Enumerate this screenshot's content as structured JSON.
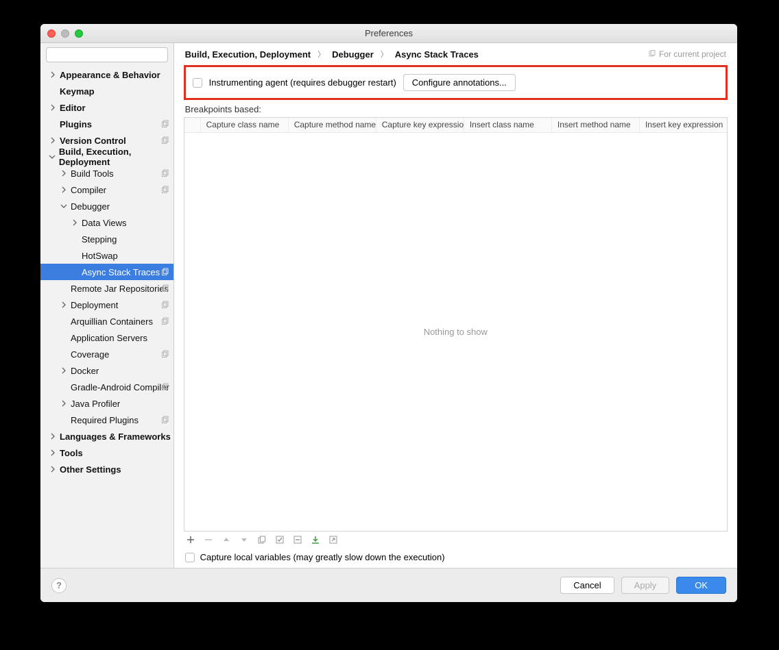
{
  "window": {
    "title": "Preferences"
  },
  "search": {
    "placeholder": ""
  },
  "sidebar": {
    "items": [
      {
        "label": "Appearance & Behavior",
        "indent": 0,
        "expand": "collapsed",
        "bold": true
      },
      {
        "label": "Keymap",
        "indent": 0,
        "expand": "none",
        "bold": true
      },
      {
        "label": "Editor",
        "indent": 0,
        "expand": "collapsed",
        "bold": true
      },
      {
        "label": "Plugins",
        "indent": 0,
        "expand": "none",
        "bold": true,
        "badge": true
      },
      {
        "label": "Version Control",
        "indent": 0,
        "expand": "collapsed",
        "bold": true,
        "badge": true
      },
      {
        "label": "Build, Execution, Deployment",
        "indent": 0,
        "expand": "expanded",
        "bold": true
      },
      {
        "label": "Build Tools",
        "indent": 1,
        "expand": "collapsed",
        "badge": true
      },
      {
        "label": "Compiler",
        "indent": 1,
        "expand": "collapsed",
        "badge": true
      },
      {
        "label": "Debugger",
        "indent": 1,
        "expand": "expanded"
      },
      {
        "label": "Data Views",
        "indent": 2,
        "expand": "collapsed"
      },
      {
        "label": "Stepping",
        "indent": 2,
        "expand": "none"
      },
      {
        "label": "HotSwap",
        "indent": 2,
        "expand": "none"
      },
      {
        "label": "Async Stack Traces",
        "indent": 2,
        "expand": "none",
        "selected": true,
        "badge": true
      },
      {
        "label": "Remote Jar Repositories",
        "indent": 1,
        "expand": "none",
        "badge": true
      },
      {
        "label": "Deployment",
        "indent": 1,
        "expand": "collapsed",
        "badge": true
      },
      {
        "label": "Arquillian Containers",
        "indent": 1,
        "expand": "none",
        "badge": true
      },
      {
        "label": "Application Servers",
        "indent": 1,
        "expand": "none"
      },
      {
        "label": "Coverage",
        "indent": 1,
        "expand": "none",
        "badge": true
      },
      {
        "label": "Docker",
        "indent": 1,
        "expand": "collapsed"
      },
      {
        "label": "Gradle-Android Compiler",
        "indent": 1,
        "expand": "none",
        "badge": true
      },
      {
        "label": "Java Profiler",
        "indent": 1,
        "expand": "collapsed"
      },
      {
        "label": "Required Plugins",
        "indent": 1,
        "expand": "none",
        "badge": true
      },
      {
        "label": "Languages & Frameworks",
        "indent": 0,
        "expand": "collapsed",
        "bold": true
      },
      {
        "label": "Tools",
        "indent": 0,
        "expand": "collapsed",
        "bold": true
      },
      {
        "label": "Other Settings",
        "indent": 0,
        "expand": "collapsed",
        "bold": true
      }
    ]
  },
  "breadcrumb": {
    "c1": "Build, Execution, Deployment",
    "c2": "Debugger",
    "c3": "Async Stack Traces",
    "scope": "For current project"
  },
  "panel": {
    "instrumenting_label": "Instrumenting agent (requires debugger restart)",
    "configure_btn": "Configure annotations...",
    "breakpoints_label": "Breakpoints based:",
    "columns": [
      "Capture class name",
      "Capture method name",
      "Capture key expression",
      "Insert class name",
      "Insert method name",
      "Insert key expression"
    ],
    "empty_text": "Nothing to show",
    "capture_local_label": "Capture local variables (may greatly slow down the execution)"
  },
  "footer": {
    "cancel": "Cancel",
    "apply": "Apply",
    "ok": "OK"
  }
}
